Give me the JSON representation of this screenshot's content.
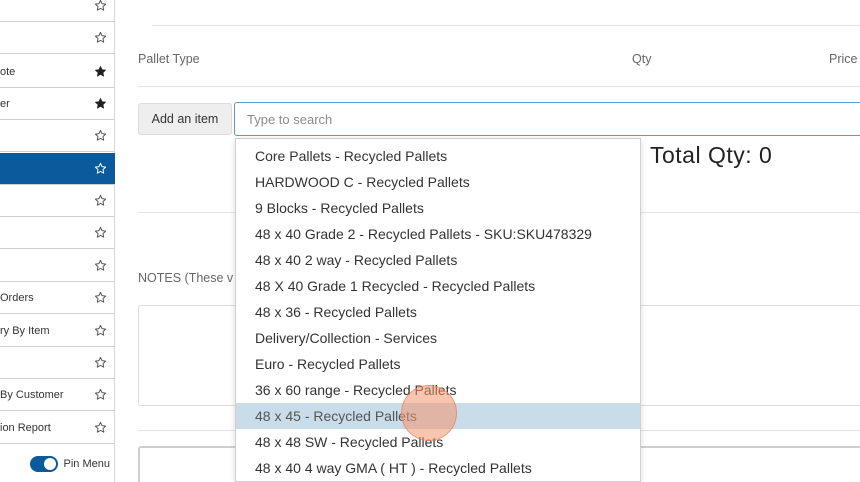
{
  "sidebar": {
    "items": [
      {
        "label": "",
        "starred": false,
        "active": false
      },
      {
        "label": "",
        "starred": false,
        "active": false
      },
      {
        "label": "ote",
        "starred": true,
        "active": false
      },
      {
        "label": "er",
        "starred": true,
        "active": false
      },
      {
        "label": "",
        "starred": false,
        "active": false
      },
      {
        "label": "",
        "starred": false,
        "active": true
      },
      {
        "label": "",
        "starred": false,
        "active": false
      },
      {
        "label": "",
        "starred": false,
        "active": false
      },
      {
        "label": "",
        "starred": false,
        "active": false
      },
      {
        "label": "Orders",
        "starred": false,
        "active": false
      },
      {
        "label": "ry By Item",
        "starred": false,
        "active": false
      },
      {
        "label": "",
        "starred": false,
        "active": false
      },
      {
        "label": "By Customer",
        "starred": false,
        "active": false
      },
      {
        "label": "ion Report",
        "starred": false,
        "active": false
      }
    ],
    "pin_menu_label": "Pin Menu",
    "pin_menu_on": true
  },
  "table": {
    "col_pallet_type": "Pallet Type",
    "col_qty": "Qty",
    "col_price": "Price"
  },
  "add_item": {
    "button_label": "Add an item",
    "search_placeholder": "Type to search"
  },
  "totals": {
    "total_qty": "Total Qty: 0"
  },
  "notes": {
    "label": "NOTES (These v"
  },
  "dropdown": {
    "items": [
      "Core Pallets - Recycled Pallets",
      "HARDWOOD C - Recycled Pallets",
      "9 Blocks - Recycled Pallets",
      "48 x 40 Grade 2 - Recycled Pallets - SKU:SKU478329",
      "48 x 40 2 way - Recycled Pallets",
      "48 X 40 Grade 1 Recycled - Recycled Pallets",
      "48 x 36 - Recycled Pallets",
      "Delivery/Collection - Services",
      "Euro - Recycled Pallets",
      "36 x 60 range - Recycled Pallets",
      "48 x 45 - Recycled Pallets",
      "48 x 48 SW - Recycled Pallets",
      "48 x 40 4 way GMA ( HT ) - Recycled Pallets"
    ],
    "selected_index": 10
  },
  "colors": {
    "accent": "#0b5a9b",
    "selected_row": "#c8dcea",
    "input_focus": "#5b9bd5"
  }
}
